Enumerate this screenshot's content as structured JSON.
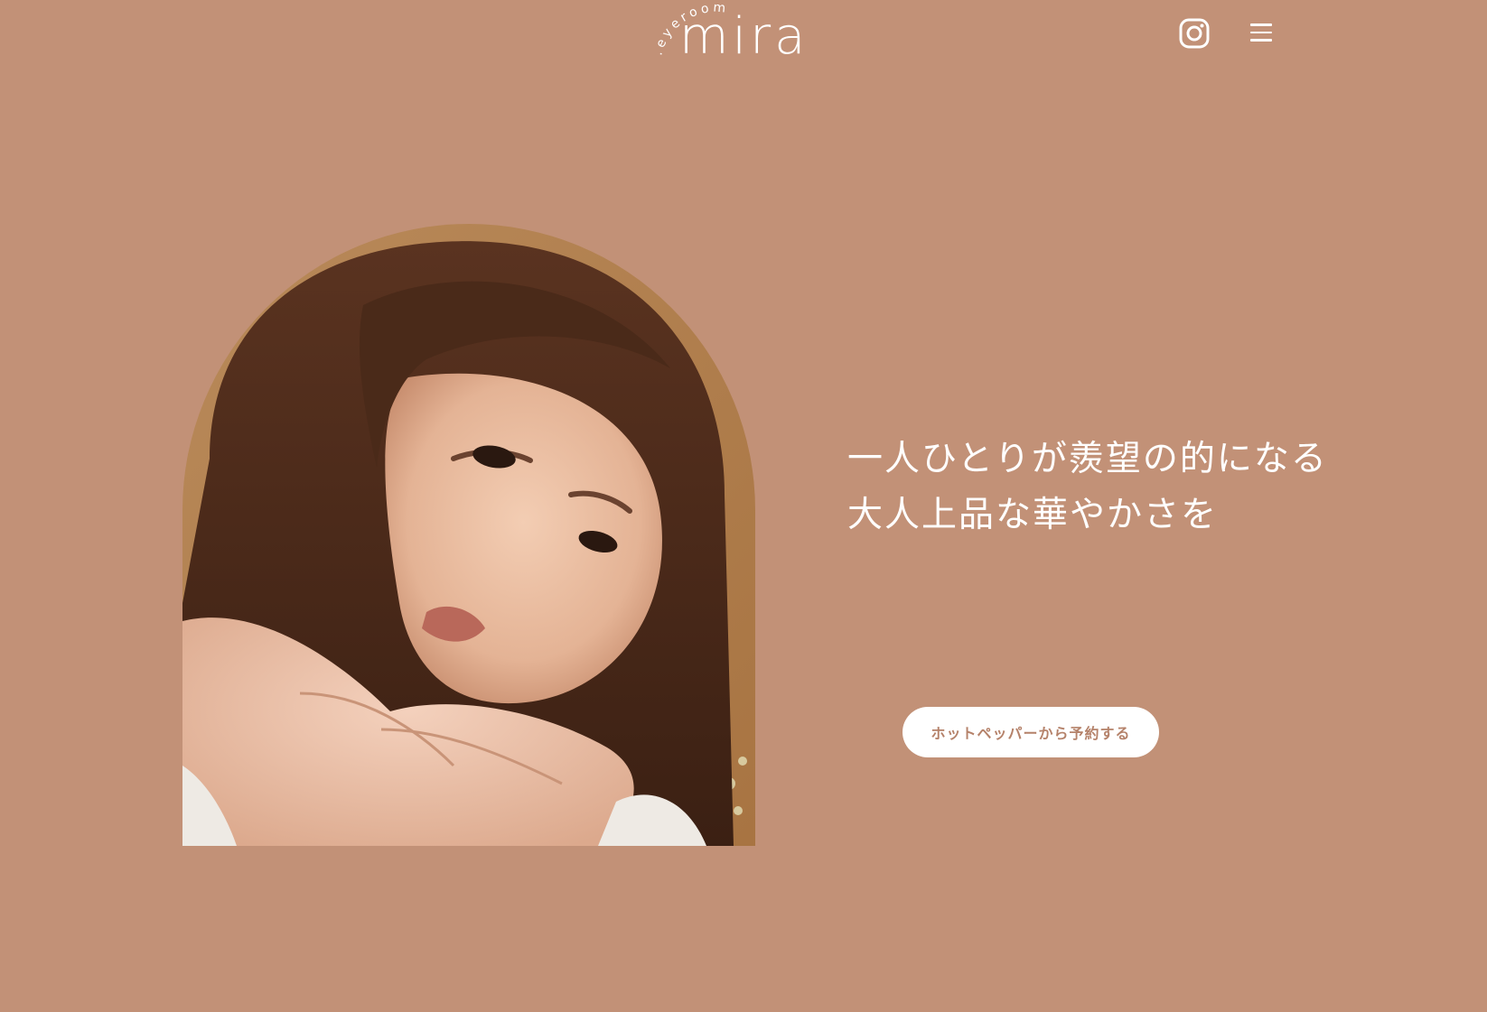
{
  "header": {
    "logo_tagline": "eyeroom",
    "logo_wordmark": "mira",
    "instagram_icon": "instagram-icon",
    "menu_icon": "hamburger-menu-icon"
  },
  "hero": {
    "headline_line1": "一人ひとりが羨望の的になる",
    "headline_line2": "大人上品な華やかさを",
    "reserve_button_label": "ホットペッパーから予約する"
  },
  "colors": {
    "background": "#c29177",
    "button_background": "#ffffff",
    "button_text": "#b5826a",
    "text": "#ffffff"
  }
}
